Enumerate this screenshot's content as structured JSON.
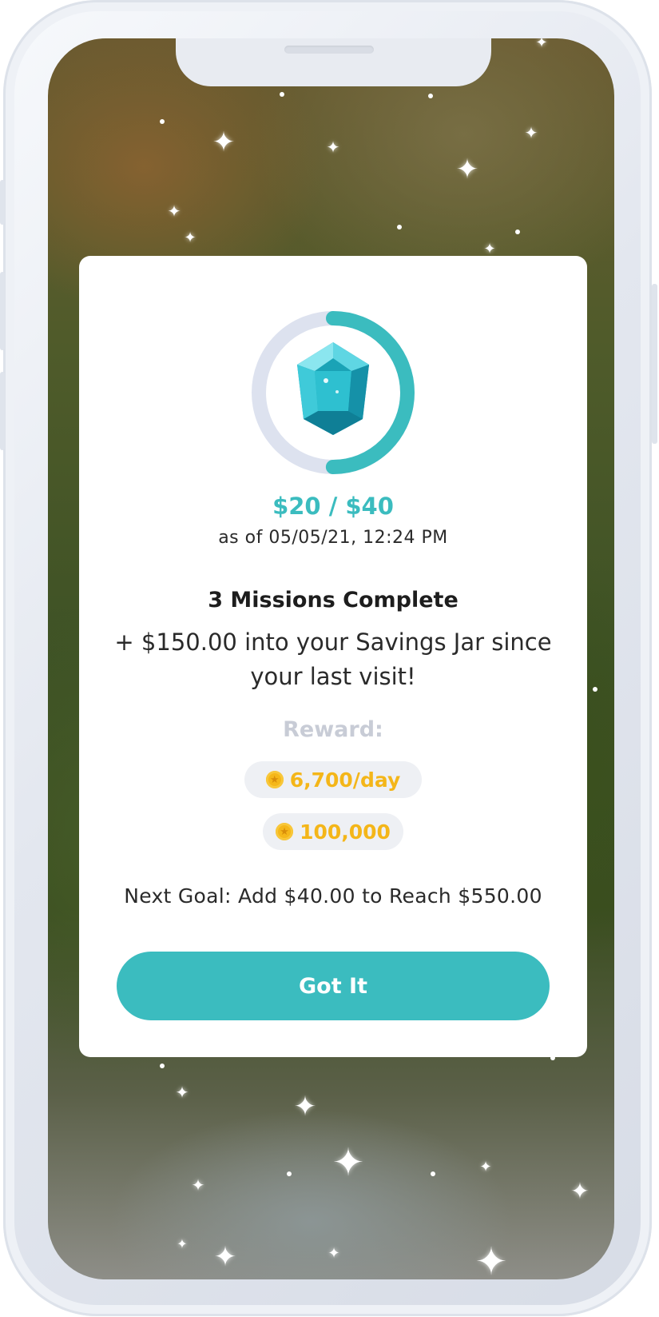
{
  "savings_goal": {
    "amount_text": "$20 / $40",
    "progress_fraction": 0.5,
    "as_of": "as of 05/05/21, 12:24 PM",
    "badge_icon": "teal-gem-icon"
  },
  "missions": {
    "title": "3 Missions Complete",
    "description": "+ $150.00 into your Savings Jar since your last visit!"
  },
  "reward": {
    "label": "Reward:",
    "items": [
      {
        "icon": "coin-icon",
        "text": "6,700/day"
      },
      {
        "icon": "coin-icon",
        "text": "100,000"
      }
    ]
  },
  "next_goal": "Next Goal: Add $40.00 to Reach $550.00",
  "cta_label": "Got It",
  "colors": {
    "accent": "#3bbcbf",
    "ring_track": "#dde2ef",
    "reward_gold": "#f4b619",
    "reward_label": "#c8ccd6",
    "pill_bg": "#eef0f4"
  }
}
